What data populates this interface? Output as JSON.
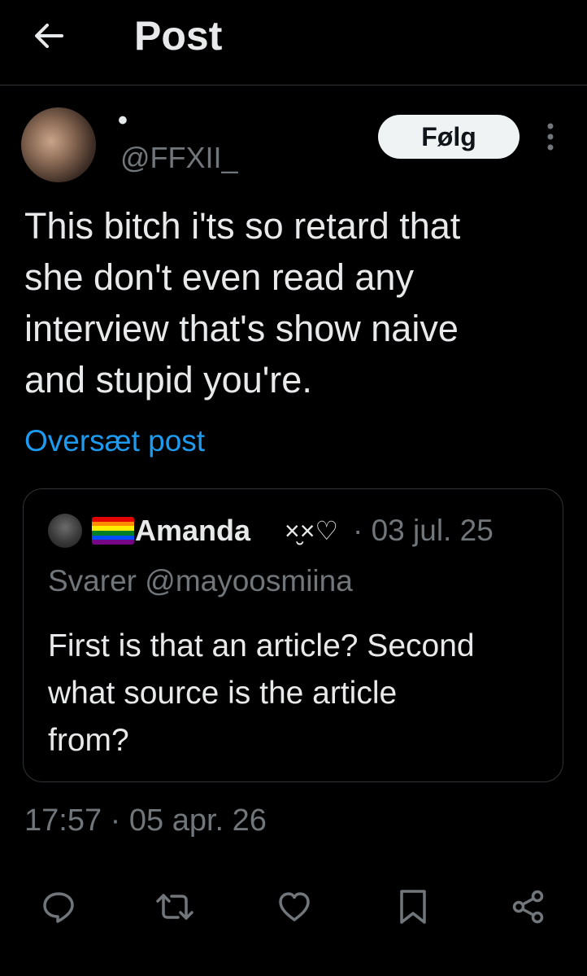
{
  "header": {
    "back_icon": "arrow-left-icon",
    "title": "Post"
  },
  "author": {
    "display_name": "•",
    "handle": "@FFXII_",
    "follow_label": "Følg",
    "more_icon": "more-vertical-icon"
  },
  "post": {
    "text": "This bitch i'ts so retard that\nshe don't even read any\ninterview that's show naive\nand stupid you're.",
    "translate_label": "Oversæt post",
    "timestamp": "17:57 · 05 apr. 26"
  },
  "quote": {
    "flag_icon": "rainbow-flag-icon",
    "name": "Amanda",
    "name_decoration": "×̮×♡",
    "date": "· 03 jul. 25",
    "reply_to": "Svarer @mayoosmiina",
    "text": "First is that an article? Second\nwhat source is the article\nfrom?"
  },
  "actions": [
    {
      "icon": "reply-icon"
    },
    {
      "icon": "repost-icon"
    },
    {
      "icon": "like-icon"
    },
    {
      "icon": "bookmark-icon"
    },
    {
      "icon": "share-icon"
    }
  ],
  "colors": {
    "background": "#000000",
    "text": "#e7e9ea",
    "secondary": "#71767b",
    "link": "#1d9bf0",
    "border": "#2f3336",
    "follow_bg": "#eff3f4"
  }
}
